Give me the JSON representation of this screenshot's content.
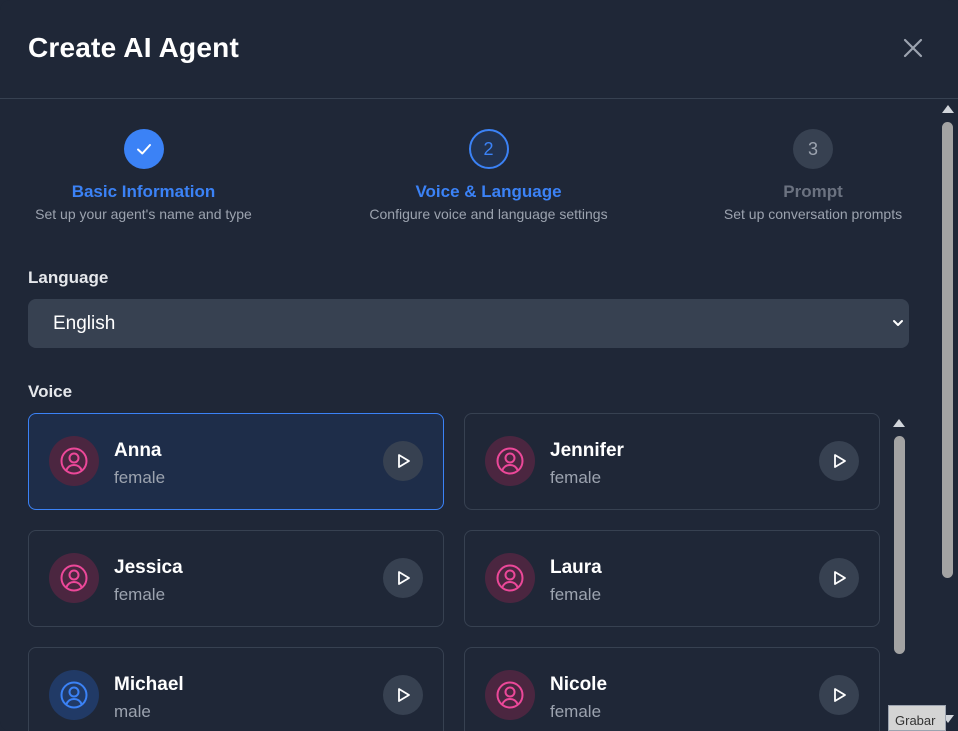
{
  "dialog": {
    "title": "Create AI Agent"
  },
  "steps": [
    {
      "number": "1",
      "label": "Basic Information",
      "desc": "Set up your agent's name and type",
      "state": "completed"
    },
    {
      "number": "2",
      "label": "Voice & Language",
      "desc": "Configure voice and language settings",
      "state": "active"
    },
    {
      "number": "3",
      "label": "Prompt",
      "desc": "Set up conversation prompts",
      "state": "pending"
    }
  ],
  "language": {
    "label": "Language",
    "value": "English"
  },
  "voice": {
    "label": "Voice",
    "options": [
      {
        "name": "Anna",
        "gender": "female",
        "selected": true
      },
      {
        "name": "Jennifer",
        "gender": "female",
        "selected": false
      },
      {
        "name": "Jessica",
        "gender": "female",
        "selected": false
      },
      {
        "name": "Laura",
        "gender": "female",
        "selected": false
      },
      {
        "name": "Michael",
        "gender": "male",
        "selected": false
      },
      {
        "name": "Nicole",
        "gender": "female",
        "selected": false
      }
    ]
  },
  "overlay": {
    "record_label": "Grabar"
  },
  "colors": {
    "accent": "#3b82f6",
    "background": "#1f2737",
    "female_icon": "#ec4899",
    "male_icon": "#3b82f6"
  }
}
